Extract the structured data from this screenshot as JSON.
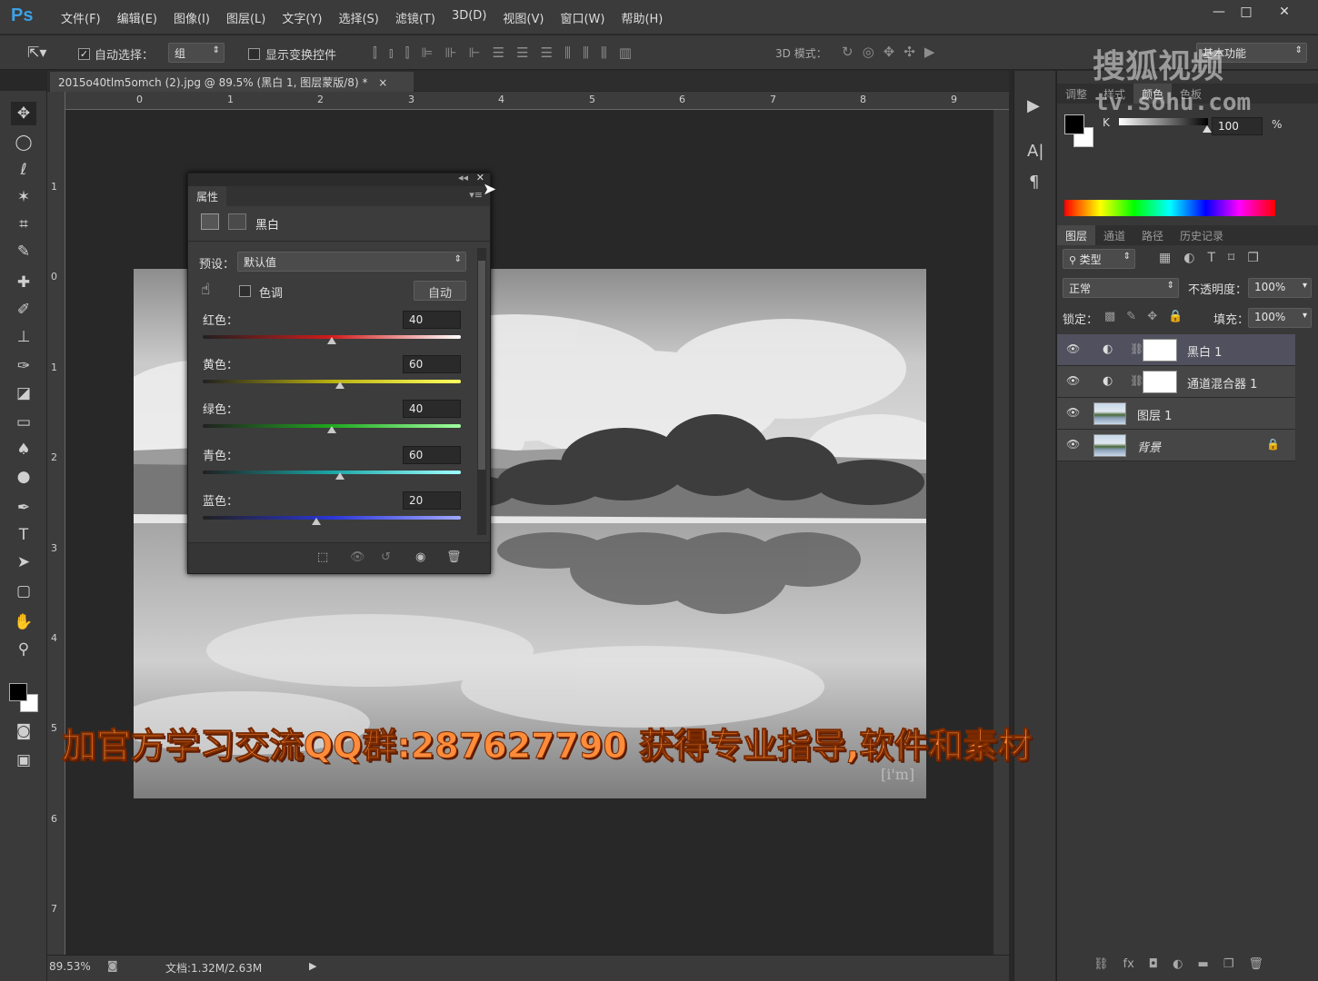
{
  "app": {
    "logo": "Ps"
  },
  "menu": [
    "文件(F)",
    "编辑(E)",
    "图像(I)",
    "图层(L)",
    "文字(Y)",
    "选择(S)",
    "滤镜(T)",
    "3D(D)",
    "视图(V)",
    "窗口(W)",
    "帮助(H)"
  ],
  "window_controls": {
    "minimize": "—",
    "maximize": "□",
    "close": "✕"
  },
  "options": {
    "auto_select_label": "自动选择：",
    "auto_select_value": "组",
    "show_transform_label": "显示变换控件",
    "mode_3d_label": "3D 模式：",
    "workspace": "基本功能"
  },
  "document": {
    "tab_title": "2015o40tlm5omch (2).jpg @ 89.5% (黑白 1, 图层蒙版/8) *",
    "tab_close": "×",
    "ruler_h": [
      "0",
      "1",
      "2",
      "3",
      "4",
      "5",
      "6",
      "7",
      "8",
      "9"
    ],
    "ruler_v": [
      "1",
      "0",
      "1",
      "2",
      "3",
      "4",
      "5",
      "6",
      "7"
    ]
  },
  "status": {
    "zoom": "89.53%",
    "doc": "文档:1.32M/2.63M"
  },
  "properties": {
    "tab": "属性",
    "adjustment": "黑白",
    "preset_label": "预设：",
    "preset_value": "默认值",
    "tint_label": "色调",
    "auto_button": "自动",
    "sliders": [
      {
        "label": "红色：",
        "value": "40",
        "level": 0.5
      },
      {
        "label": "黄色：",
        "value": "60",
        "level": 0.53
      },
      {
        "label": "绿色：",
        "value": "40",
        "level": 0.5
      },
      {
        "label": "青色：",
        "value": "60",
        "level": 0.53
      },
      {
        "label": "蓝色：",
        "value": "20",
        "level": 0.44
      }
    ]
  },
  "color_panel": {
    "tabs": [
      "调整",
      "样式",
      "颜色",
      "色板"
    ],
    "active_tab": "颜色",
    "channel": "K",
    "value": "100",
    "unit": "%"
  },
  "layers_panel": {
    "tabs": [
      "图层",
      "通道",
      "路径",
      "历史记录"
    ],
    "filter_label": "类型",
    "blend_mode": "正常",
    "opacity_label": "不透明度：",
    "opacity_value": "100%",
    "lock_label": "锁定：",
    "fill_label": "填充：",
    "fill_value": "100%",
    "layers": [
      {
        "name": "黑白 1",
        "type": "adjustment",
        "selected": true
      },
      {
        "name": "通道混合器 1",
        "type": "adjustment",
        "selected": false
      },
      {
        "name": "图层 1",
        "type": "image",
        "selected": false
      },
      {
        "name": "背景",
        "type": "image",
        "selected": false,
        "locked": true
      }
    ]
  },
  "watermark": {
    "line1": "搜狐视频",
    "line2": "tv.sohu.com"
  },
  "caption": "加官方学习交流QQ群:287627790  获得专业指导,软件和素材",
  "photo_mark": "[i'm]"
}
